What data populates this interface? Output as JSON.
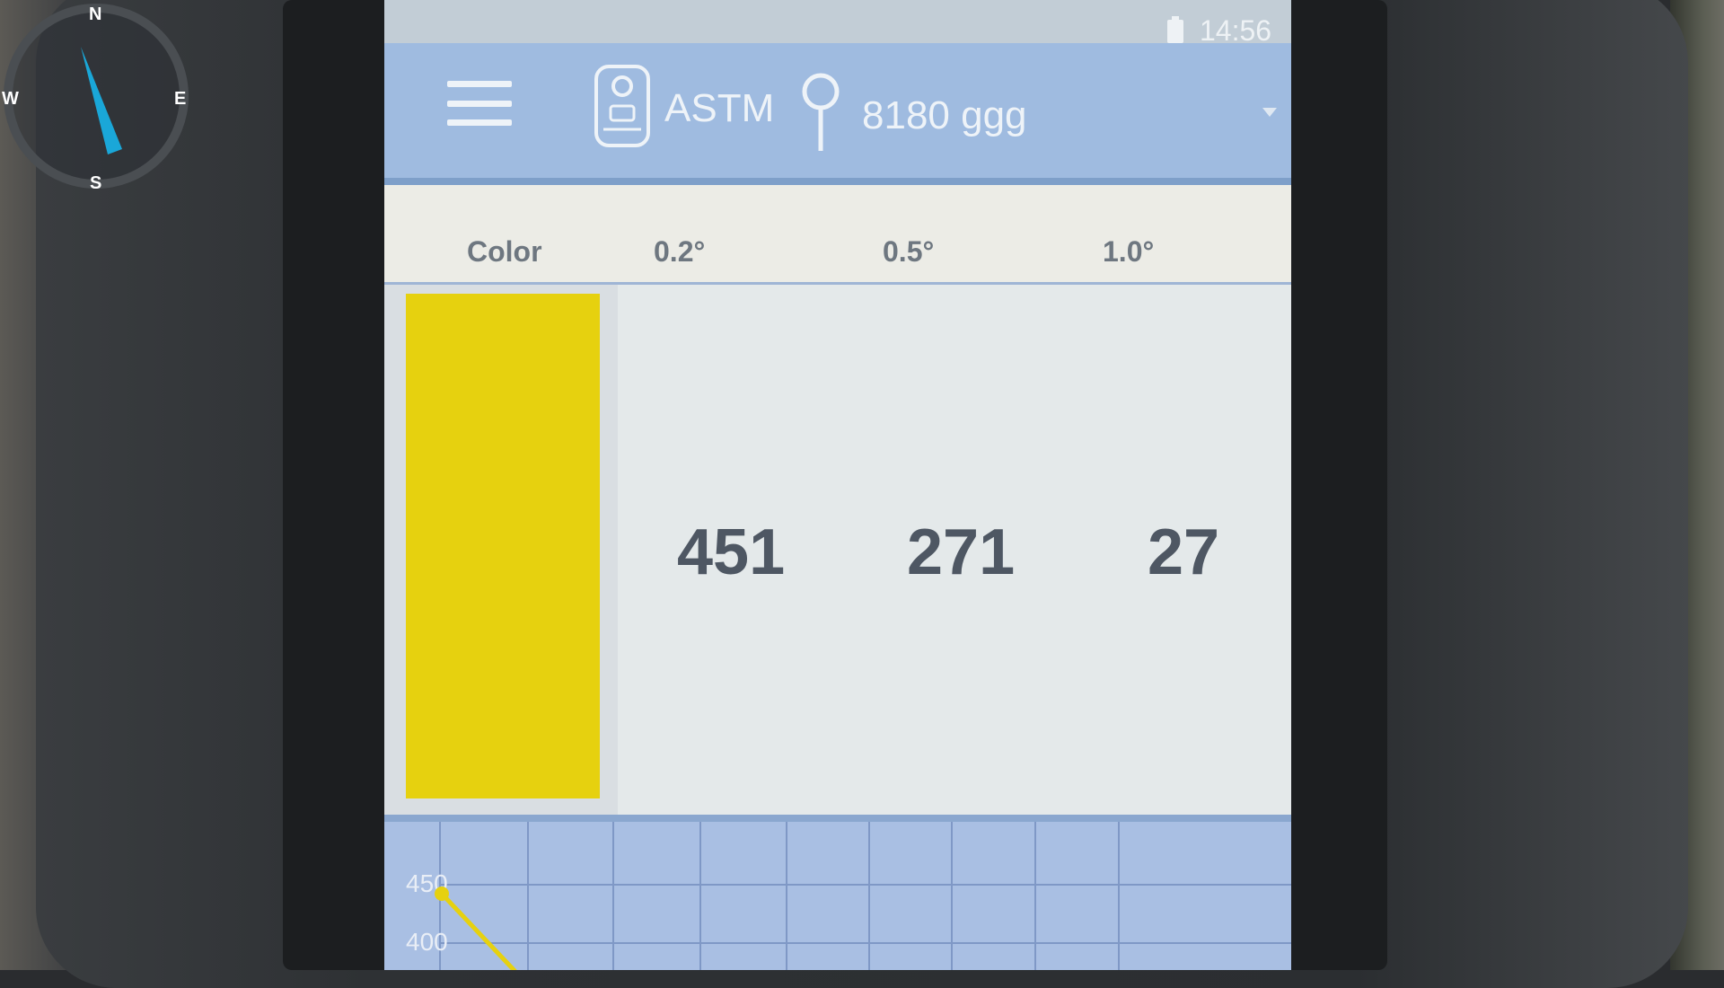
{
  "status_bar": {
    "time": "14:56"
  },
  "header": {
    "standard": "ASTM",
    "sample": "8180 ggg"
  },
  "table": {
    "headers": [
      "Color",
      "0.2°",
      "0.5°",
      "1.0°"
    ],
    "readings": [
      "451",
      "271",
      "27"
    ],
    "color_hex": "#e6d10f"
  },
  "chart_data": {
    "type": "line",
    "y_ticks": [
      "450",
      "400"
    ],
    "series": [
      {
        "values": [
          450,
          380
        ]
      }
    ],
    "line_color": "#e6d10f"
  },
  "compass": {
    "north": "N",
    "south": "S",
    "east": "E",
    "west": "W",
    "needle_color": "#1aa7d8"
  },
  "colors": {
    "header": "#9fbbe0",
    "accent": "#e6d10f"
  }
}
